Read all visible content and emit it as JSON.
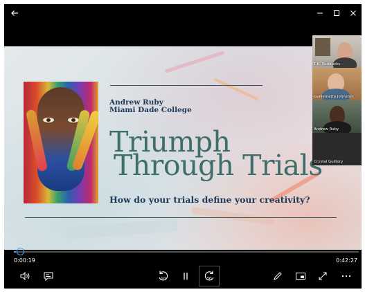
{
  "window": {
    "back_icon": "arrow-left-icon",
    "minimize_icon": "minimize-icon",
    "maximize_icon": "maximize-icon",
    "close_icon": "close-icon"
  },
  "slide": {
    "author_name": "Andrew Ruby",
    "institution": "Miami Dade College",
    "title_line1": "Triumph",
    "title_line2": "Through Trials",
    "question": "How do your trials define your creativity?"
  },
  "participants": [
    {
      "name": "T.K. Rudducks"
    },
    {
      "name": "Guillemette Johnston"
    },
    {
      "name": "Andrew Ruby"
    },
    {
      "name": "Crystal Guillory"
    }
  ],
  "playback": {
    "current_time": "0:00:19",
    "total_time": "0:42:27",
    "progress_fraction": 0.007,
    "skip_back_label": "10",
    "skip_forward_label": "30"
  },
  "controls": {
    "volume_icon": "volume-icon",
    "captions_icon": "captions-icon",
    "skip_back_icon": "skip-back-10-icon",
    "pause_icon": "pause-icon",
    "skip_forward_icon": "skip-forward-30-icon",
    "pen_icon": "pen-icon",
    "miniplayer_icon": "miniplayer-icon",
    "fullscreen_icon": "fullscreen-icon",
    "more_icon": "more-icon"
  }
}
